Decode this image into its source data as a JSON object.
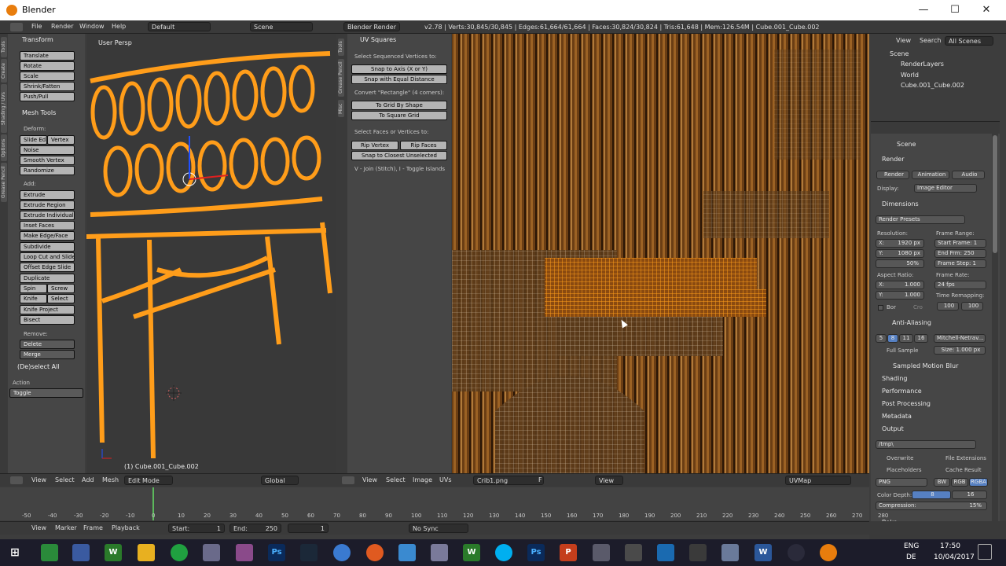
{
  "window": {
    "title": "Blender",
    "min": "—",
    "max": "☐",
    "close": "✕"
  },
  "topbar": {
    "menus": [
      "File",
      "Render",
      "Window",
      "Help"
    ],
    "layout": "Default",
    "scene": "Scene",
    "engine": "Blender Render",
    "stats": "v2.78 | Verts:30,845/30,845 | Edges:61,664/61,664 | Faces:30,824/30,824 | Tris:61,648 | Mem:126.54M | Cube.001_Cube.002"
  },
  "toolshelf": {
    "vtabs": [
      "Tools",
      "Create",
      "Shading / UVs",
      "Options",
      "Grease Pencil"
    ],
    "transform_title": "Transform",
    "transform": [
      "Translate",
      "Rotate",
      "Scale",
      "Shrink/Fatten",
      "Push/Pull"
    ],
    "meshtools_title": "Mesh Tools",
    "deform_label": "Deform:",
    "slide_edge": "Slide Ed",
    "vertex": "Vertex",
    "deform": [
      "Noise",
      "Smooth Vertex",
      "Randomize"
    ],
    "add_label": "Add:",
    "extrude": "Extrude",
    "add": [
      "Extrude Region",
      "Extrude Individual",
      "Inset Faces",
      "Make Edge/Face",
      "Subdivide",
      "Loop Cut and Slide",
      "Offset Edge Slide",
      "Duplicate"
    ],
    "spin": "Spin",
    "screw": "Screw",
    "knife": "Knife",
    "select": "Select",
    "knife_project": "Knife Project",
    "bisect": "Bisect",
    "remove_label": "Remove:",
    "delete": "Delete",
    "merge": "Merge",
    "deselect_title": "(De)select All",
    "action_label": "Action",
    "action_value": "Toggle"
  },
  "viewport": {
    "label": "User Persp",
    "object": "(1) Cube.001_Cube.002"
  },
  "viewport_header": {
    "view": "View",
    "select": "Select",
    "add": "Add",
    "mesh": "Mesh",
    "mode": "Edit Mode",
    "pivot": "Global"
  },
  "uvtools": {
    "tabs": [
      "Tools",
      "Grease Pencil",
      "Misc"
    ],
    "title": "UV Squares",
    "sel_label": "Select Sequenced Vertices to:",
    "snap_axis": "Snap to Axis (X or Y)",
    "snap_dist": "Snap with Equal Distance",
    "convert_label": "Convert \"Rectangle\" (4 corners):",
    "grid_shape": "To Grid By Shape",
    "square_grid": "To Square Grid",
    "faces_label": "Select Faces or Vertices to:",
    "rip_vertex": "Rip Vertex",
    "rip_faces": "Rip Faces",
    "snap_closest": "Snap to Closest Unselected",
    "hint": "V - Join (Stitch), I - Toggle Islands"
  },
  "uv_header": {
    "view": "View",
    "select": "Select",
    "image": "Image",
    "uvs": "UVs",
    "image_name": "Crib1.png",
    "f": "F",
    "view2": "View",
    "uvmap": "UVMap"
  },
  "outliner": {
    "view": "View",
    "search": "Search",
    "filter": "All Scenes",
    "items": [
      "Scene",
      "RenderLayers",
      "World",
      "Cube.001_Cube.002"
    ]
  },
  "props": {
    "scene": "Scene",
    "render_title": "Render",
    "render_btn": "Render",
    "animation_btn": "Animation",
    "audio_btn": "Audio",
    "display_label": "Display:",
    "display_value": "Image Editor",
    "dimensions_title": "Dimensions",
    "presets": "Render Presets",
    "resolution_label": "Resolution:",
    "res_x": "X:",
    "res_x_val": "1920 px",
    "res_y": "Y:",
    "res_y_val": "1080 px",
    "res_pct": "50%",
    "frame_range_label": "Frame Range:",
    "start_frame": "Start Frame: 1",
    "end_frame": "End Frm: 250",
    "frame_step": "Frame Step: 1",
    "aspect_label": "Aspect Ratio:",
    "asp_x": "X:",
    "asp_x_val": "1.000",
    "asp_y": "Y:",
    "asp_y_val": "1.000",
    "frame_rate_label": "Frame Rate:",
    "fps": "24 fps",
    "time_remap_label": "Time Remapping:",
    "remap_old": "100",
    "remap_new": "100",
    "bor": "Bor",
    "cro": "Cro",
    "aa_title": "Anti-Aliasing",
    "aa_samples": [
      "5",
      "8",
      "11",
      "16"
    ],
    "aa_filter": "Mitchell-Netrav...",
    "full_sample": "Full Sample",
    "aa_size": "Size: 1.000 px",
    "motion_blur": "Sampled Motion Blur",
    "collapsed": [
      "Shading",
      "Performance",
      "Post Processing",
      "Metadata"
    ],
    "output_title": "Output",
    "output_path": "/tmp\\",
    "overwrite": "Overwrite",
    "file_ext": "File Extensions",
    "placeholders": "Placeholders",
    "cache_result": "Cache Result",
    "format": "PNG",
    "bw": "BW",
    "rgb": "RGB",
    "rgba": "RGBA",
    "color_depth_label": "Color Depth:",
    "depth_8": "8",
    "depth_16": "16",
    "compression": "Compression:",
    "compression_val": "15%",
    "bake": "Bake"
  },
  "timeline": {
    "ticks": [
      "-50",
      "-40",
      "-30",
      "-20",
      "-10",
      "0",
      "10",
      "20",
      "30",
      "40",
      "50",
      "60",
      "70",
      "80",
      "90",
      "100",
      "110",
      "120",
      "130",
      "140",
      "150",
      "160",
      "170",
      "180",
      "190",
      "200",
      "210",
      "220",
      "230",
      "240",
      "250",
      "260",
      "270",
      "280"
    ],
    "view": "View",
    "marker": "Marker",
    "frame": "Frame",
    "playback": "Playback",
    "start": "Start:",
    "start_val": "1",
    "end": "End:",
    "end_val": "250",
    "current": "1",
    "sync": "No Sync"
  },
  "taskbar": {
    "apps": [
      "W",
      "Ps",
      "W",
      "Ps",
      "P",
      "W"
    ],
    "lang1": "ENG",
    "lang2": "DE",
    "time": "17:50",
    "date": "10/04/2017"
  }
}
